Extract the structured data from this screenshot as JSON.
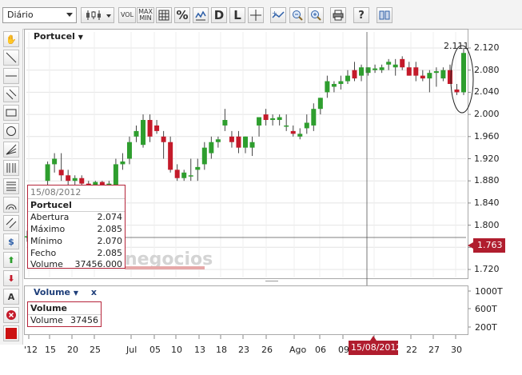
{
  "toolbar": {
    "period_select": "Diário",
    "buttons": [
      {
        "name": "candlestick-type-button",
        "icon": "candlestick-icon"
      },
      {
        "name": "volume-button",
        "label": "VOL"
      },
      {
        "name": "maxmin-button",
        "label": "MAX\nMIN"
      },
      {
        "name": "grid-button",
        "icon": "grid-icon"
      },
      {
        "name": "percent-button",
        "label": "%"
      },
      {
        "name": "compare-button",
        "icon": "compare-icon"
      },
      {
        "name": "d-button",
        "label": "D"
      },
      {
        "name": "l-button",
        "label": "L"
      },
      {
        "name": "crosshair-button",
        "icon": "crosshair-icon"
      },
      {
        "name": "indicator-button",
        "icon": "indicator-icon"
      },
      {
        "name": "zoom-out-button",
        "icon": "zoom-out-icon"
      },
      {
        "name": "zoom-in-button",
        "icon": "zoom-in-icon"
      },
      {
        "name": "print-button",
        "icon": "print-icon"
      },
      {
        "name": "help-button",
        "label": "?"
      },
      {
        "name": "book-button",
        "icon": "book-icon"
      }
    ]
  },
  "sidebar": {
    "tools": [
      "hand-icon",
      "line-icon",
      "horizontal-line-icon",
      "parallel-lines-icon",
      "rectangle-icon",
      "ellipse-icon",
      "fan-icon",
      "fibonacci-icon",
      "fibonacci-retracement-icon",
      "arc-icon",
      "channel-icon",
      "dollar-icon",
      "arrow-up-icon",
      "arrow-down-icon",
      "text-icon",
      "delete-icon",
      "color-swatch-icon"
    ]
  },
  "price_panel": {
    "symbol": "Portucel",
    "last_value_label": "2.111",
    "cursor_price": "1.763",
    "watermark": "negocios",
    "y_ticks": [
      "2.120",
      "2.080",
      "2.040",
      "2.000",
      "1.960",
      "1.920",
      "1.880",
      "1.840",
      "1.800",
      "1.760",
      "1.720"
    ]
  },
  "info_box": {
    "date": "15/08/2012",
    "title": "Portucel",
    "rows": [
      {
        "label": "Abertura",
        "value": "2.074"
      },
      {
        "label": "Máximo",
        "value": "2.085"
      },
      {
        "label": "Mínimo",
        "value": "2.070"
      },
      {
        "label": "Fecho",
        "value": "2.085"
      },
      {
        "label": "Volume",
        "value": "37456.000"
      }
    ]
  },
  "volume_panel": {
    "title": "Volume",
    "close_label": "x",
    "box_title": "Volume",
    "box_label": "Volume",
    "box_value": "37456",
    "y_ticks": [
      "1000T",
      "600T",
      "200T"
    ]
  },
  "x_axis": {
    "labels": [
      "'12",
      "15",
      "20",
      "25",
      "Jul",
      "05",
      "10",
      "13",
      "18",
      "23",
      "26",
      "Ago",
      "06",
      "09",
      "17",
      "22",
      "27",
      "30"
    ],
    "cursor_date": "15/08/2012"
  },
  "colors": {
    "up": "#2e9e2e",
    "down": "#c41a2a",
    "volume": "#1f5fb5",
    "accent": "#b01d2e"
  },
  "chart_data": {
    "type": "candlestick",
    "ylim": [
      1.7,
      2.13
    ],
    "candles": [
      {
        "o": 1.78,
        "h": 1.79,
        "l": 1.77,
        "c": 1.78
      },
      {
        "o": 1.8,
        "h": 1.83,
        "l": 1.77,
        "c": 1.79
      },
      {
        "o": 1.85,
        "h": 1.87,
        "l": 1.84,
        "c": 1.86
      },
      {
        "o": 1.88,
        "h": 1.915,
        "l": 1.87,
        "c": 1.91
      },
      {
        "o": 1.91,
        "h": 1.93,
        "l": 1.895,
        "c": 1.92
      },
      {
        "o": 1.9,
        "h": 1.93,
        "l": 1.88,
        "c": 1.89
      },
      {
        "o": 1.89,
        "h": 1.9,
        "l": 1.87,
        "c": 1.88
      },
      {
        "o": 1.88,
        "h": 1.89,
        "l": 1.87,
        "c": 1.885
      },
      {
        "o": 1.885,
        "h": 1.89,
        "l": 1.87,
        "c": 1.875
      },
      {
        "o": 1.875,
        "h": 1.88,
        "l": 1.86,
        "c": 1.87
      },
      {
        "o": 1.87,
        "h": 1.88,
        "l": 1.86,
        "c": 1.878
      },
      {
        "o": 1.878,
        "h": 1.88,
        "l": 1.855,
        "c": 1.86
      },
      {
        "o": 1.87,
        "h": 1.88,
        "l": 1.86,
        "c": 1.875
      },
      {
        "o": 1.87,
        "h": 1.92,
        "l": 1.86,
        "c": 1.91
      },
      {
        "o": 1.91,
        "h": 1.93,
        "l": 1.9,
        "c": 1.915
      },
      {
        "o": 1.92,
        "h": 1.96,
        "l": 1.91,
        "c": 1.95
      },
      {
        "o": 1.96,
        "h": 1.98,
        "l": 1.95,
        "c": 1.97
      },
      {
        "o": 1.945,
        "h": 2.0,
        "l": 1.94,
        "c": 1.99
      },
      {
        "o": 1.99,
        "h": 2.0,
        "l": 1.95,
        "c": 1.96
      },
      {
        "o": 1.98,
        "h": 1.99,
        "l": 1.965,
        "c": 1.97
      },
      {
        "o": 1.96,
        "h": 1.97,
        "l": 1.92,
        "c": 1.95
      },
      {
        "o": 1.95,
        "h": 1.96,
        "l": 1.895,
        "c": 1.9
      },
      {
        "o": 1.9,
        "h": 1.91,
        "l": 1.88,
        "c": 1.885
      },
      {
        "o": 1.885,
        "h": 1.9,
        "l": 1.88,
        "c": 1.895
      },
      {
        "o": 1.89,
        "h": 1.92,
        "l": 1.88,
        "c": 1.89
      },
      {
        "o": 1.9,
        "h": 1.92,
        "l": 1.88,
        "c": 1.905
      },
      {
        "o": 1.91,
        "h": 1.95,
        "l": 1.9,
        "c": 1.94
      },
      {
        "o": 1.93,
        "h": 1.96,
        "l": 1.92,
        "c": 1.95
      },
      {
        "o": 1.95,
        "h": 1.96,
        "l": 1.94,
        "c": 1.955
      },
      {
        "o": 1.98,
        "h": 2.01,
        "l": 1.97,
        "c": 1.99
      },
      {
        "o": 1.96,
        "h": 1.97,
        "l": 1.94,
        "c": 1.95
      },
      {
        "o": 1.96,
        "h": 1.97,
        "l": 1.93,
        "c": 1.94
      },
      {
        "o": 1.94,
        "h": 1.96,
        "l": 1.93,
        "c": 1.96
      },
      {
        "o": 1.94,
        "h": 1.96,
        "l": 1.925,
        "c": 1.95
      },
      {
        "o": 1.98,
        "h": 1.99,
        "l": 1.96,
        "c": 1.995
      },
      {
        "o": 2.0,
        "h": 2.01,
        "l": 1.98,
        "c": 1.99
      },
      {
        "o": 1.99,
        "h": 2.0,
        "l": 1.98,
        "c": 1.993
      },
      {
        "o": 1.99,
        "h": 2.0,
        "l": 1.98,
        "c": 1.995
      },
      {
        "o": 1.98,
        "h": 2.0,
        "l": 1.97,
        "c": 1.98
      },
      {
        "o": 1.97,
        "h": 1.98,
        "l": 1.96,
        "c": 1.965
      },
      {
        "o": 1.96,
        "h": 1.975,
        "l": 1.955,
        "c": 1.965
      },
      {
        "o": 1.975,
        "h": 2.0,
        "l": 1.965,
        "c": 1.985
      },
      {
        "o": 1.98,
        "h": 2.02,
        "l": 1.97,
        "c": 2.01
      },
      {
        "o": 2.01,
        "h": 2.03,
        "l": 2.0,
        "c": 2.03
      },
      {
        "o": 2.04,
        "h": 2.07,
        "l": 2.03,
        "c": 2.06
      },
      {
        "o": 2.05,
        "h": 2.06,
        "l": 2.04,
        "c": 2.055
      },
      {
        "o": 2.055,
        "h": 2.07,
        "l": 2.045,
        "c": 2.06
      },
      {
        "o": 2.06,
        "h": 2.08,
        "l": 2.055,
        "c": 2.07
      },
      {
        "o": 2.08,
        "h": 2.095,
        "l": 2.06,
        "c": 2.065
      },
      {
        "o": 2.07,
        "h": 2.09,
        "l": 2.06,
        "c": 2.085
      },
      {
        "o": 2.075,
        "h": 2.085,
        "l": 2.07,
        "c": 2.085
      },
      {
        "o": 2.08,
        "h": 2.09,
        "l": 2.075,
        "c": 2.083
      },
      {
        "o": 2.08,
        "h": 2.09,
        "l": 2.075,
        "c": 2.085
      },
      {
        "o": 2.09,
        "h": 2.1,
        "l": 2.08,
        "c": 2.095
      },
      {
        "o": 2.085,
        "h": 2.1,
        "l": 2.07,
        "c": 2.09
      },
      {
        "o": 2.1,
        "h": 2.105,
        "l": 2.08,
        "c": 2.085
      },
      {
        "o": 2.085,
        "h": 2.095,
        "l": 2.07,
        "c": 2.07
      },
      {
        "o": 2.085,
        "h": 2.095,
        "l": 2.06,
        "c": 2.07
      },
      {
        "o": 2.07,
        "h": 2.08,
        "l": 2.06,
        "c": 2.065
      },
      {
        "o": 2.065,
        "h": 2.08,
        "l": 2.04,
        "c": 2.075
      },
      {
        "o": 2.075,
        "h": 2.085,
        "l": 2.05,
        "c": 2.078
      },
      {
        "o": 2.065,
        "h": 2.085,
        "l": 2.06,
        "c": 2.08
      },
      {
        "o": 2.08,
        "h": 2.09,
        "l": 2.06,
        "c": 2.055
      },
      {
        "o": 2.045,
        "h": 2.055,
        "l": 2.035,
        "c": 2.04
      },
      {
        "o": 2.04,
        "h": 2.12,
        "l": 2.035,
        "c": 2.111
      }
    ],
    "volume_thousands": [
      130,
      80,
      130,
      150,
      120,
      140,
      80,
      130,
      160,
      120,
      110,
      120,
      100,
      90,
      180,
      110,
      160,
      190,
      210,
      180,
      150,
      260,
      210,
      170,
      140,
      160,
      130,
      200,
      170,
      200,
      600,
      170,
      130,
      200,
      160,
      180,
      130,
      120,
      160,
      240,
      320,
      180,
      130,
      200,
      260,
      120,
      150,
      110,
      140,
      180,
      160,
      120,
      200,
      130,
      150,
      220,
      150,
      160,
      170,
      130,
      140,
      110,
      200,
      160,
      180
    ]
  }
}
